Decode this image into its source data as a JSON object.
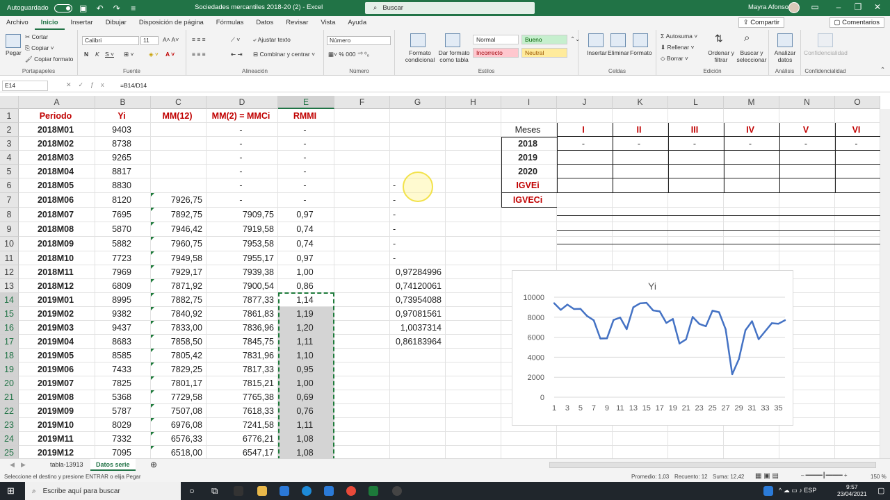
{
  "titlebar": {
    "autosave_label": "Autoguardado",
    "doc_title": "Sociedades mercantiles 2018-20 (2)  -  Excel",
    "search_placeholder": "Buscar",
    "user_name": "Mayra Afonso"
  },
  "menu_tabs": [
    "Archivo",
    "Inicio",
    "Insertar",
    "Dibujar",
    "Disposición de página",
    "Fórmulas",
    "Datos",
    "Revisar",
    "Vista",
    "Ayuda"
  ],
  "share_label": "Compartir",
  "comments_label": "Comentarios",
  "ribbon": {
    "clipboard": {
      "paste": "Pegar",
      "cut": "Cortar",
      "copy": "Copiar",
      "format_painter": "Copiar formato",
      "label": "Portapapeles"
    },
    "font": {
      "name": "Calibri",
      "size": "11",
      "label": "Fuente"
    },
    "alignment": {
      "wrap": "Ajustar texto",
      "merge": "Combinar y centrar",
      "label": "Alineación"
    },
    "number": {
      "format": "Número",
      "label": "Número"
    },
    "styles": {
      "conditional": "Formato condicional",
      "table": "Dar formato como tabla",
      "normal": "Normal",
      "good": "Bueno",
      "bad": "Incorrecto",
      "neutral": "Neutral",
      "label": "Estilos"
    },
    "cells": {
      "insert": "Insertar",
      "delete": "Eliminar",
      "format": "Formato",
      "label": "Celdas"
    },
    "editing": {
      "autosum": "Autosuma",
      "fill": "Rellenar",
      "clear": "Borrar",
      "sort": "Ordenar y filtrar",
      "find": "Buscar y seleccionar",
      "label": "Edición"
    },
    "analysis": {
      "analyze": "Analizar datos",
      "label": "Análisis"
    },
    "confidentiality": {
      "button": "Confidencialidad",
      "label": "Confidencialidad"
    }
  },
  "formula_bar": {
    "name_box": "E14",
    "formula": "=B14/D14"
  },
  "columns": [
    "A",
    "B",
    "C",
    "D",
    "E",
    "F",
    "G",
    "H",
    "I",
    "J",
    "K",
    "L",
    "M",
    "N",
    "O"
  ],
  "headers": {
    "periodo": "Periodo",
    "yi": "Yi",
    "mm12": "MM(12)",
    "mm2": "MM(2) = MMCi",
    "rmmi": "RMMI"
  },
  "rows": [
    {
      "n": "2",
      "a": "2018M01",
      "b": "9403",
      "c": "",
      "d": "-",
      "e": "-",
      "g": ""
    },
    {
      "n": "3",
      "a": "2018M02",
      "b": "8738",
      "c": "",
      "d": "-",
      "e": "-",
      "g": ""
    },
    {
      "n": "4",
      "a": "2018M03",
      "b": "9265",
      "c": "",
      "d": "-",
      "e": "-",
      "g": ""
    },
    {
      "n": "5",
      "a": "2018M04",
      "b": "8817",
      "c": "",
      "d": "-",
      "e": "-",
      "g": ""
    },
    {
      "n": "6",
      "a": "2018M05",
      "b": "8830",
      "c": "",
      "d": "-",
      "e": "-",
      "g": "-"
    },
    {
      "n": "7",
      "a": "2018M06",
      "b": "8120",
      "c": "7926,75",
      "d": "-",
      "e": "-",
      "g": "-"
    },
    {
      "n": "8",
      "a": "2018M07",
      "b": "7695",
      "c": "7892,75",
      "d": "7909,75",
      "e": "0,97",
      "g": "-"
    },
    {
      "n": "9",
      "a": "2018M08",
      "b": "5870",
      "c": "7946,42",
      "d": "7919,58",
      "e": "0,74",
      "g": "-"
    },
    {
      "n": "10",
      "a": "2018M09",
      "b": "5882",
      "c": "7960,75",
      "d": "7953,58",
      "e": "0,74",
      "g": "-"
    },
    {
      "n": "11",
      "a": "2018M10",
      "b": "7723",
      "c": "7949,58",
      "d": "7955,17",
      "e": "0,97",
      "g": "-"
    },
    {
      "n": "12",
      "a": "2018M11",
      "b": "7969",
      "c": "7929,17",
      "d": "7939,38",
      "e": "1,00",
      "g": "0,97284996"
    },
    {
      "n": "13",
      "a": "2018M12",
      "b": "6809",
      "c": "7871,92",
      "d": "7900,54",
      "e": "0,86",
      "g": "0,74120061"
    },
    {
      "n": "14",
      "a": "2019M01",
      "b": "8995",
      "c": "7882,75",
      "d": "7877,33",
      "e": "1,14",
      "g": "0,73954088"
    },
    {
      "n": "15",
      "a": "2019M02",
      "b": "9382",
      "c": "7840,92",
      "d": "7861,83",
      "e": "1,19",
      "g": "0,97081561"
    },
    {
      "n": "16",
      "a": "2019M03",
      "b": "9437",
      "c": "7833,00",
      "d": "7836,96",
      "e": "1,20",
      "g": "1,0037314"
    },
    {
      "n": "17",
      "a": "2019M04",
      "b": "8683",
      "c": "7858,50",
      "d": "7845,75",
      "e": "1,11",
      "g": "0,86183964"
    },
    {
      "n": "18",
      "a": "2019M05",
      "b": "8585",
      "c": "7805,42",
      "d": "7831,96",
      "e": "1,10",
      "g": ""
    },
    {
      "n": "19",
      "a": "2019M06",
      "b": "7433",
      "c": "7829,25",
      "d": "7817,33",
      "e": "0,95",
      "g": ""
    },
    {
      "n": "20",
      "a": "2019M07",
      "b": "7825",
      "c": "7801,17",
      "d": "7815,21",
      "e": "1,00",
      "g": ""
    },
    {
      "n": "21",
      "a": "2019M08",
      "b": "5368",
      "c": "7729,58",
      "d": "7765,38",
      "e": "0,69",
      "g": ""
    },
    {
      "n": "22",
      "a": "2019M09",
      "b": "5787",
      "c": "7507,08",
      "d": "7618,33",
      "e": "0,76",
      "g": ""
    },
    {
      "n": "23",
      "a": "2019M10",
      "b": "8029",
      "c": "6976,08",
      "d": "7241,58",
      "e": "1,11",
      "g": ""
    },
    {
      "n": "24",
      "a": "2019M11",
      "b": "7332",
      "c": "6576,33",
      "d": "6776,21",
      "e": "1,08",
      "g": ""
    },
    {
      "n": "25",
      "a": "2019M12",
      "b": "7095",
      "c": "6518,00",
      "d": "6547,17",
      "e": "1,08",
      "g": ""
    }
  ],
  "seasonal_table": {
    "corner": "Meses",
    "months": [
      "I",
      "II",
      "III",
      "IV",
      "V",
      "VI"
    ],
    "row_labels": [
      "2018",
      "2019",
      "2020",
      "IGVEi",
      "IGVECi"
    ],
    "row_2018": [
      "-",
      "-",
      "-",
      "-",
      "-",
      "-"
    ]
  },
  "chart_data": {
    "type": "line",
    "title": "Yi",
    "x": [
      1,
      2,
      3,
      4,
      5,
      6,
      7,
      8,
      9,
      10,
      11,
      12,
      13,
      14,
      15,
      16,
      17,
      18,
      19,
      20,
      21,
      22,
      23,
      24,
      25,
      26,
      27,
      28,
      29,
      30,
      31,
      32,
      33,
      34,
      35,
      36
    ],
    "x_tick_labels": [
      "1",
      "3",
      "5",
      "7",
      "9",
      "11",
      "13",
      "15",
      "17",
      "19",
      "21",
      "23",
      "25",
      "27",
      "29",
      "31",
      "33",
      "35"
    ],
    "y_tick_labels": [
      "0",
      "2000",
      "4000",
      "6000",
      "8000",
      "10000"
    ],
    "ylim": [
      0,
      10000
    ],
    "series": [
      {
        "values": [
          9403,
          8738,
          9265,
          8817,
          8830,
          8120,
          7695,
          5870,
          5882,
          7723,
          7969,
          6809,
          8995,
          9382,
          9437,
          8683,
          8585,
          7433,
          7825,
          5368,
          5787,
          8029,
          7332,
          7095,
          8650,
          8500,
          6800,
          2300,
          3800,
          6700,
          7600,
          5800,
          6600,
          7400,
          7350,
          7700
        ]
      }
    ],
    "grid": "horizontal",
    "color": "#4472c4"
  },
  "sheet_tabs": [
    "tabla-13913",
    "Datos serie"
  ],
  "status": {
    "message": "Seleccione el destino y presione ENTRAR o elija Pegar",
    "average": "Promedio: 1,03",
    "count": "Recuento: 12",
    "sum": "Suma: 12,42",
    "zoom": "150 %"
  },
  "taskbar": {
    "search_placeholder": "Escribe aquí para buscar",
    "time": "9:57",
    "date": "23/04/2021"
  }
}
